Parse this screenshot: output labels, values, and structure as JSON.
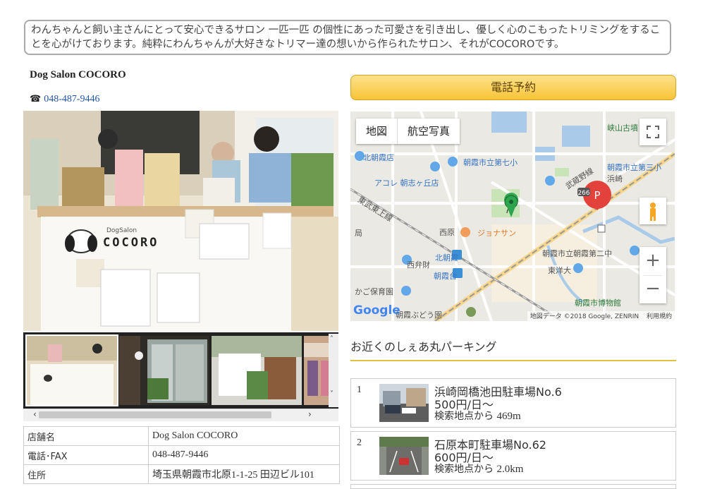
{
  "intro_text": "わんちゃんと飼い主さんにとって安心できるサロン 一匹一匹 の個性にあった可愛さを引き出し、優しく心のこもったトリミングをすることを心がけております。純粋にわんちゃんが大好きなトリマー達の想いから作られたサロン、それがCOCOROです。",
  "shop": {
    "name": "Dog Salon COCORO",
    "phone_icon": "☎",
    "phone": "048-487-9446",
    "photo_sign_small": "DogSalon",
    "photo_sign_big": "COCORO"
  },
  "gallery": {
    "prev_arrow": "‹",
    "next_arrow": "›",
    "up_arrow": "˄",
    "down_arrow": "˅"
  },
  "info_table": [
    {
      "key": "店舗名",
      "value": "Dog Salon COCORO"
    },
    {
      "key": "電話･FAX",
      "value": "048-487-9446"
    },
    {
      "key": "住所",
      "value": "埼玉県朝霞市北原1-1-25 田辺ビル101"
    }
  ],
  "call_button": "電話予約",
  "map": {
    "type_map": "地図",
    "type_aerial": "航空写真",
    "zoom_in": "+",
    "zoom_out": "−",
    "fullscreen_icon": "fullscreen-icon",
    "pegman_icon": "pegman-icon",
    "marker_letter": "P",
    "labels": {
      "kitaasaka_st": "北朝霞店",
      "asaka_7": "朝霞市立第七小",
      "asaka_3": "朝霞市立第三小",
      "hamasaki": "浜崎",
      "kyozan": "峡山古墳",
      "acore": "アコレ 朝志ヶ丘店",
      "tobu": "東武東上線",
      "musashino": "武蔵野線",
      "nishibara": "西原",
      "jonathan": "ジョナサン",
      "kita_asaka": "北朝霞",
      "asakadai": "朝霞台",
      "nishibenzai": "西弁財",
      "asaka_2chu": "朝霞市立朝霞第二中",
      "toyodai": "東洋大",
      "hoikuen": "かご保育園",
      "museum": "朝霞市博物館",
      "budoen": "朝霞ぶどう園",
      "station_mark": "局",
      "route_266": "266",
      "attribution": "地図データ ©2018 Google, ZENRIN",
      "terms": "利用規約",
      "google": "Google"
    }
  },
  "parking": {
    "title": "お近くのしぇあ丸パーキング",
    "items": [
      {
        "num": "1",
        "name": "浜崎岡橋池田駐車場No.6",
        "price": "500円/日〜",
        "dist_label": "検索地点から",
        "dist": "469m"
      },
      {
        "num": "2",
        "name": "石原本町駐車場No.62",
        "price": "600円/日〜",
        "dist_label": "検索地点から",
        "dist": "2.0km"
      }
    ]
  },
  "colors": {
    "link": "#2355a6",
    "button_top": "#fde28c",
    "button_bottom": "#f8c437",
    "accent_line": "#e5c03a",
    "marker": "#e2423b"
  }
}
